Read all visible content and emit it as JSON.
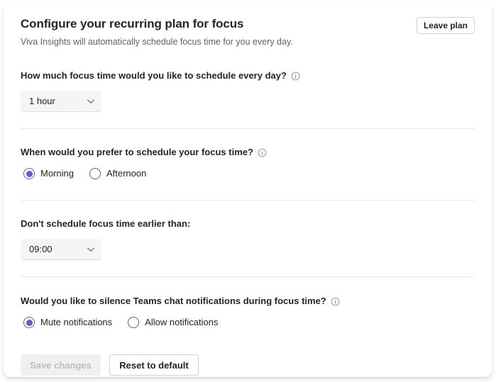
{
  "card": {
    "header": {
      "title": "Configure your recurring plan for focus",
      "subtitle": "Viva Insights will automatically schedule focus time for you every day.",
      "leave_plan_label": "Leave plan"
    },
    "sections": [
      {
        "question": "How much focus time would you like to schedule every day?",
        "has_info_icon": true,
        "info_icon": "info-circle-icon",
        "control": "dropdown",
        "dropdown": {
          "value": "1 hour",
          "chevron_icon": "chevron-down-icon"
        }
      },
      {
        "question": "When would you prefer to schedule your focus time?",
        "has_info_icon": true,
        "info_icon": "info-circle-icon",
        "control": "radio-group",
        "options": [
          {
            "label": "Morning",
            "selected": true
          },
          {
            "label": "Afternoon",
            "selected": false
          }
        ]
      },
      {
        "question": "Don't schedule focus time earlier than:",
        "has_info_icon": false,
        "control": "dropdown",
        "dropdown": {
          "value": "09:00",
          "chevron_icon": "chevron-down-icon"
        }
      },
      {
        "question": "Would you like to silence Teams chat notifications during focus time?",
        "has_info_icon": true,
        "info_icon": "info-circle-icon",
        "control": "radio-group",
        "options": [
          {
            "label": "Mute notifications",
            "selected": true
          },
          {
            "label": "Allow notifications",
            "selected": false
          }
        ]
      }
    ],
    "footer": {
      "save_label": "Save changes",
      "save_disabled": true,
      "reset_label": "Reset to default"
    }
  },
  "colors": {
    "accent_purple": "#5b5fc7",
    "text_primary": "#242424",
    "text_secondary": "#616161",
    "text_disabled": "#bdbdbd",
    "divider": "#e8e8e8",
    "control_bg": "#f5f5f5",
    "card_bg": "#ffffff"
  }
}
